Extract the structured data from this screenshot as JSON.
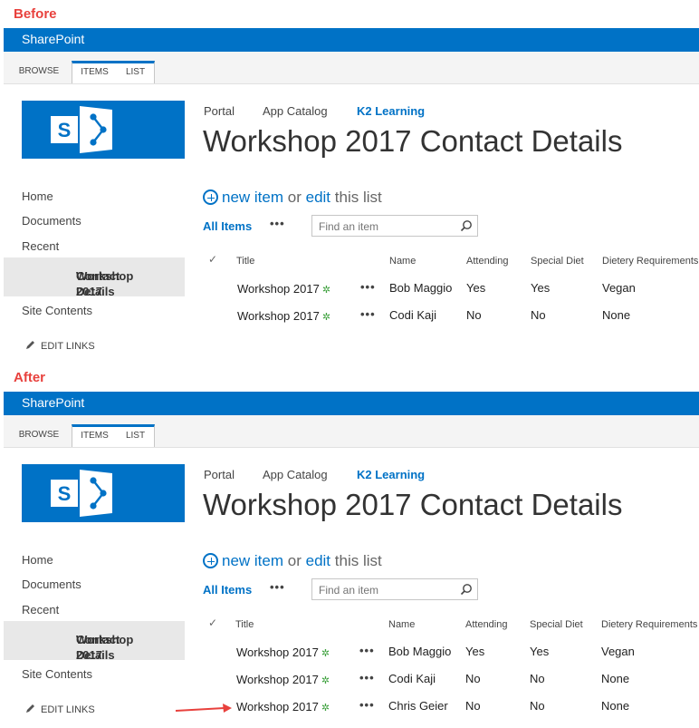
{
  "panels": [
    {
      "label": "Before",
      "suite_bar": "SharePoint",
      "ribbon_tabs": [
        "BROWSE",
        "ITEMS",
        "LIST"
      ],
      "top_nav": [
        "Portal",
        "App Catalog",
        "K2 Learning"
      ],
      "page_title": "Workshop 2017 Contact Details",
      "quick_launch": [
        "Home",
        "Documents",
        "Recent"
      ],
      "quick_launch_selected": [
        "Workshop 2017",
        "Contact Details"
      ],
      "quick_launch_site": "Site Contents",
      "edit_links": "EDIT LINKS",
      "new_item": {
        "plus_text": "new item",
        "or": "or",
        "edit": "edit",
        "rest": "this list"
      },
      "view": "All Items",
      "search_placeholder": "Find an item",
      "columns": [
        "Title",
        "Name",
        "Attending",
        "Special Diet",
        "Dietery Requirements"
      ],
      "rows": [
        [
          "Workshop 2017",
          "Bob Maggio",
          "Yes",
          "Yes",
          "Vegan"
        ],
        [
          "Workshop 2017",
          "Codi Kaji",
          "No",
          "No",
          "None"
        ]
      ]
    },
    {
      "label": "After",
      "suite_bar": "SharePoint",
      "ribbon_tabs": [
        "BROWSE",
        "ITEMS",
        "LIST"
      ],
      "top_nav": [
        "Portal",
        "App Catalog",
        "K2 Learning"
      ],
      "page_title": "Workshop 2017 Contact Details",
      "quick_launch": [
        "Home",
        "Documents",
        "Recent"
      ],
      "quick_launch_selected": [
        "Workshop 2017",
        "Contact Details"
      ],
      "quick_launch_site": "Site Contents",
      "edit_links": "EDIT LINKS",
      "new_item": {
        "plus_text": "new item",
        "or": "or",
        "edit": "edit",
        "rest": "this list"
      },
      "view": "All Items",
      "search_placeholder": "Find an item",
      "columns": [
        "Title",
        "Name",
        "Attending",
        "Special Diet",
        "Dietery Requirements"
      ],
      "rows": [
        [
          "Workshop 2017",
          "Bob Maggio",
          "Yes",
          "Yes",
          "Vegan"
        ],
        [
          "Workshop 2017",
          "Codi Kaji",
          "No",
          "No",
          "None"
        ],
        [
          "Workshop 2017",
          "Chris Geier",
          "No",
          "No",
          "None"
        ]
      ]
    }
  ],
  "colors": {
    "brand": "#0072c6",
    "label": "#e8413d",
    "new_star": "#3ba03b"
  },
  "icons": [
    "sharepoint-logo-icon",
    "plus-circle-icon",
    "search-icon",
    "pencil-icon",
    "checkmark-icon",
    "new-item-star-icon",
    "ellipsis-icon",
    "red-arrow-icon"
  ]
}
